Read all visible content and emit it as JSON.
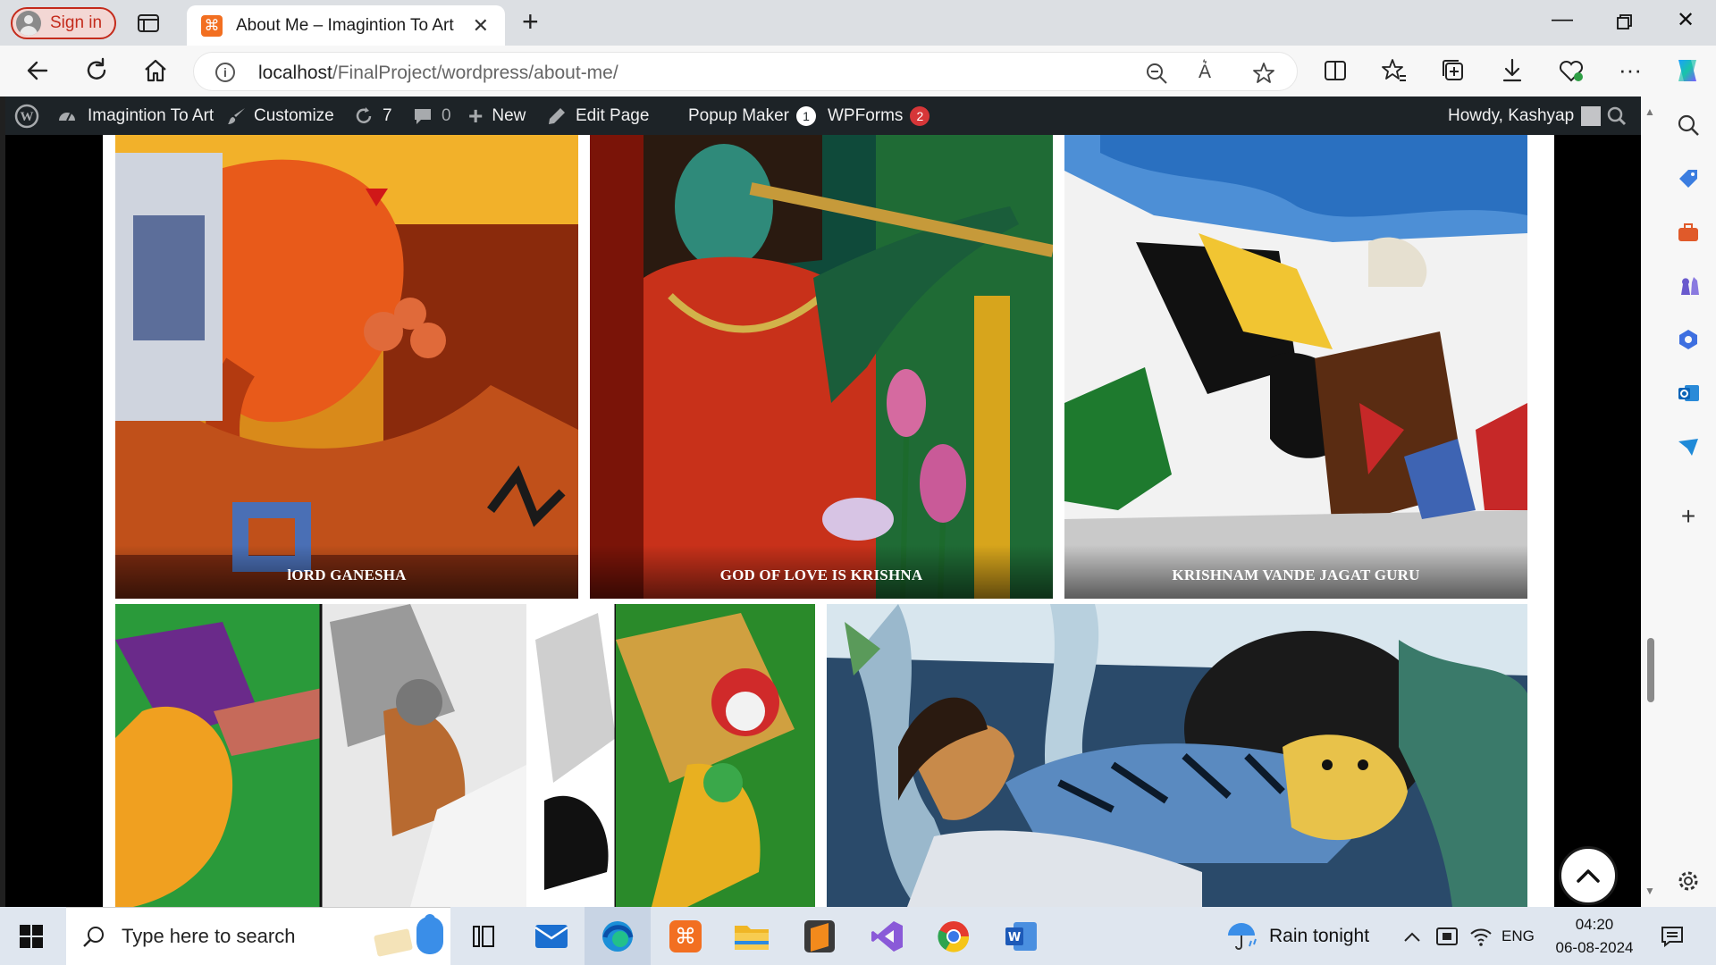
{
  "browser": {
    "signin_label": "Sign in",
    "tab_title": "About Me – Imagintion To Art",
    "url_host": "localhost",
    "url_path": "/FinalProject/wordpress/about-me/"
  },
  "wpbar": {
    "site_name": "Imagintion To Art",
    "customize": "Customize",
    "updates_count": "7",
    "comments_count": "0",
    "new_label": "New",
    "edit_page": "Edit Page",
    "popup_maker": "Popup Maker",
    "popup_maker_count": "1",
    "wpforms": "WPForms",
    "wpforms_count": "2",
    "howdy": "Howdy, Kashyap"
  },
  "gallery": {
    "row1": [
      {
        "caption": "lORD GANESHA"
      },
      {
        "caption": "GOD OF LOVE IS KRISHNA"
      },
      {
        "caption": "KRISHNAM VANDE JAGAT GURU"
      }
    ]
  },
  "taskbar": {
    "search_placeholder": "Type here to search",
    "weather": "Rain tonight",
    "language": "ENG",
    "time": "04:20",
    "date": "06-08-2024"
  },
  "colors": {
    "wpbar_bg": "#1d2327",
    "badge_popup": "#ffffff",
    "badge_wpforms": "#d63638",
    "edge_accent": "#c42b1c"
  }
}
